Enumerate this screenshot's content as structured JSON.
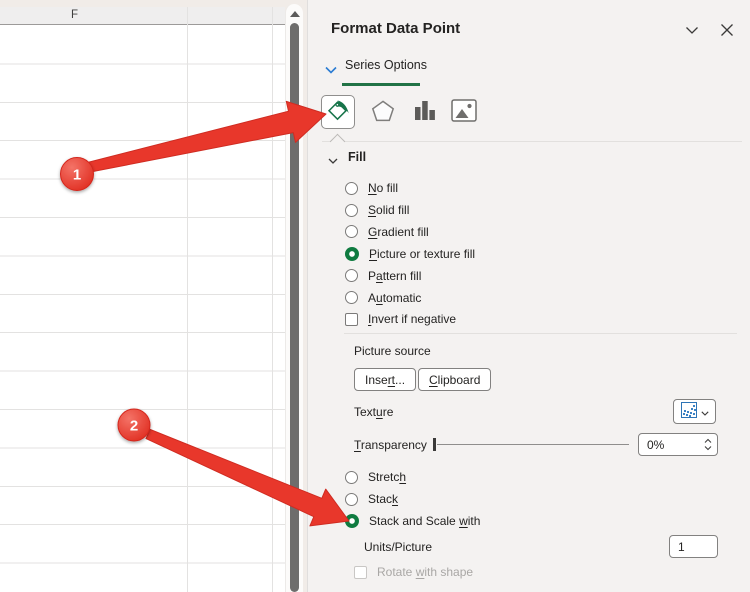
{
  "spreadsheet": {
    "column_header": "F"
  },
  "panel": {
    "title": "Format Data Point",
    "header_icons": {
      "collapse": "chevron-down-icon",
      "close": "close-icon"
    },
    "series_options_tab": {
      "label": "Series Options",
      "chevron": "chevron-down-icon"
    },
    "format_tabs": [
      {
        "name": "fill-line",
        "icon": "paint-bucket-icon",
        "selected": true
      },
      {
        "name": "effects",
        "icon": "pentagon-icon",
        "selected": false
      },
      {
        "name": "series-options",
        "icon": "bar-chart-icon",
        "selected": false
      },
      {
        "name": "picture-fill",
        "icon": "picture-icon",
        "selected": false
      }
    ],
    "fill": {
      "heading": "Fill",
      "options": [
        {
          "before": "",
          "u": "N",
          "after": "o fill",
          "selected": false
        },
        {
          "before": "",
          "u": "S",
          "after": "olid fill",
          "selected": false
        },
        {
          "before": "",
          "u": "G",
          "after": "radient fill",
          "selected": false
        },
        {
          "before": "",
          "u": "P",
          "after": "icture or texture fill",
          "selected": true
        },
        {
          "before": "P",
          "u": "a",
          "after": "ttern fill",
          "selected": false
        },
        {
          "before": "A",
          "u": "u",
          "after": "tomatic",
          "selected": false
        }
      ],
      "invert_negative": {
        "before": "",
        "u": "I",
        "after": "nvert if negative",
        "checked": false
      }
    },
    "picture_source": {
      "label": "Picture source",
      "insert": {
        "before": "Inse",
        "u": "rt",
        "after": "..."
      },
      "clipboard": {
        "before": "",
        "u": "C",
        "after": "lipboard"
      }
    },
    "texture": {
      "label": {
        "before": "Text",
        "u": "u",
        "after": "re"
      },
      "dropdown_icon": "texture-preview-icon"
    },
    "transparency": {
      "label": {
        "before": "",
        "u": "T",
        "after": "ransparency"
      },
      "value": "0%",
      "slider_percent": 0
    },
    "stack_options": [
      {
        "before": "Stretc",
        "u": "h",
        "after": "",
        "selected": false
      },
      {
        "before": "Stac",
        "u": "k",
        "after": "",
        "selected": false
      },
      {
        "before": "Stack and Scale ",
        "u": "w",
        "after": "ith",
        "selected": true
      }
    ],
    "units_per_picture": {
      "label": "Units/Picture",
      "value": "1"
    },
    "rotate_with_shape": {
      "label": {
        "before": "Rotate ",
        "u": "w",
        "after": "ith shape"
      },
      "checked": false,
      "disabled": true
    }
  },
  "annotations": {
    "step1": "1",
    "step2": "2"
  },
  "colors": {
    "accent_green": "#107C41",
    "tab_underline_green": "#217346",
    "series_chevron_blue": "#2B7CD3",
    "annotation_red": "#E8372B",
    "panel_bg": "#F4F2F1"
  }
}
